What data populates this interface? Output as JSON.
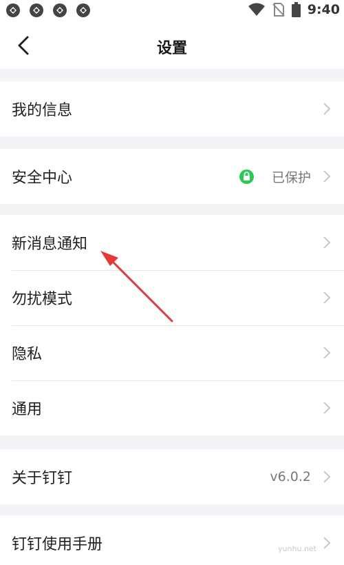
{
  "status_bar": {
    "time": "9:40",
    "notification_icons": [
      "app-icon",
      "app-icon",
      "app-icon",
      "app-icon"
    ]
  },
  "header": {
    "title": "设置"
  },
  "groups": [
    {
      "items": [
        {
          "label": "我的信息",
          "value": ""
        }
      ]
    },
    {
      "items": [
        {
          "label": "安全中心",
          "value": "已保护",
          "badge": "shield-icon"
        }
      ]
    },
    {
      "items": [
        {
          "label": "新消息通知",
          "value": ""
        },
        {
          "label": "勿扰模式",
          "value": ""
        },
        {
          "label": "隐私",
          "value": ""
        },
        {
          "label": "通用",
          "value": ""
        }
      ]
    },
    {
      "items": [
        {
          "label": "关于钉钉",
          "value": "v6.0.2"
        }
      ]
    },
    {
      "items": [
        {
          "label": "钉钉使用手册",
          "value": ""
        }
      ]
    }
  ],
  "watermark": "yunhu.net",
  "colors": {
    "background": "#f2f2f7",
    "accent_green": "#2ac94f",
    "annotation_arrow": "#e53935",
    "chevron": "#c7c7cc"
  }
}
